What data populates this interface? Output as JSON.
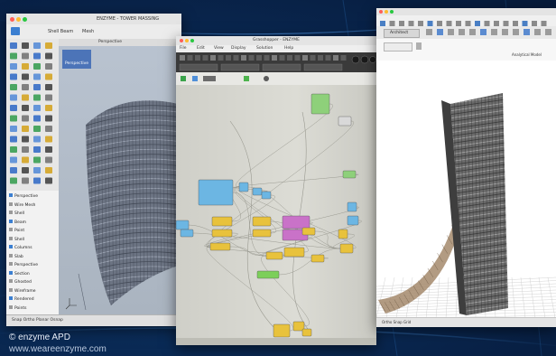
{
  "credit": {
    "line1": "© enzyme APD",
    "line2": "www.weareenzyme.com"
  },
  "rhino_window": {
    "title": "ENZYME - TOWER MASSING",
    "toolbar_left": "Shell Beam",
    "toolbar_mid": "Mesh",
    "viewport_tab": "Perspective",
    "viewport_label": "Perspective",
    "panel_items": [
      "Perspective",
      "Wire Mesh",
      "Shell",
      "Beam",
      "Point",
      "Shell",
      "Columns",
      "Slab",
      "Perspective",
      "Section",
      "Ghosted",
      "Wireframe",
      "Rendered",
      "Points"
    ],
    "status": "Snap  Ortho  Planar  Osnap"
  },
  "grasshopper_window": {
    "title": "Grasshopper - ENZYME",
    "menu": [
      "File",
      "Edit",
      "View",
      "Display",
      "Solution",
      "Help"
    ],
    "tabs": [
      "Params",
      "Maths",
      "Sets",
      "Vector",
      "Curve",
      "Surface",
      "Mesh",
      "Intersect",
      "Transform"
    ]
  },
  "model_window": {
    "title": "Analytical Model",
    "toolbar_label": "Architect",
    "status": "Ortho  Snap  Grid"
  }
}
